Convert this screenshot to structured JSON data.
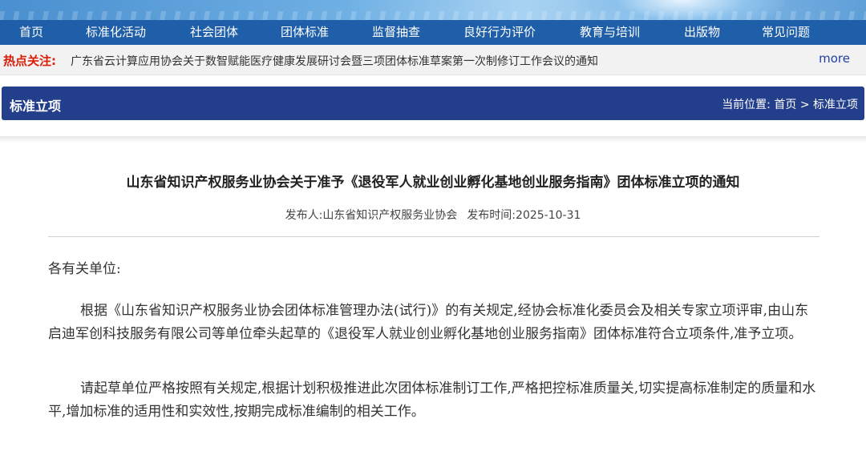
{
  "nav": {
    "items": [
      "首页",
      "标准化活动",
      "社会团体",
      "团体标准",
      "监督抽查",
      "良好行为评价",
      "教育与培训",
      "出版物",
      "常见问题"
    ]
  },
  "hot": {
    "label": "热点关注:",
    "text": "广东省云计算应用协会关于数智赋能医疗健康发展研讨会暨三项团体标准草案第一次制修订工作会议的通知",
    "more": "more"
  },
  "section": {
    "title": "标准立项",
    "crumb_prefix": "当前位置:",
    "crumb_home": "首页",
    "crumb_sep": ">",
    "crumb_current": "标准立项"
  },
  "article": {
    "title": "山东省知识产权服务业协会关于准予《退役军人就业创业孵化基地创业服务指南》团体标准立项的通知",
    "publisher_label": "发布人:",
    "publisher": "山东省知识产权服务业协会",
    "date_label": "发布时间:",
    "date": "2025-10-31",
    "salutation": "各有关单位:",
    "paragraph1": "根据《山东省知识产权服务业协会团体标准管理办法(试行)》的有关规定,经协会标准化委员会及相关专家立项评审,由山东启迪军创科技服务有限公司等单位牵头起草的《退役军人就业创业孵化基地创业服务指南》团体标准符合立项条件,准予立项。",
    "paragraph2": "请起草单位严格按照有关规定,根据计划积极推进此次团体标准制订工作,严格把控标准质量关,切实提高标准制定的质量和水平,增加标准的适用性和实效性,按期完成标准编制的相关工作。"
  },
  "colors": {
    "nav_bg": "#1f5ea8",
    "section_bg": "#233e8b",
    "hot_label": "#d81e06",
    "more_link": "#1f3ea8"
  }
}
